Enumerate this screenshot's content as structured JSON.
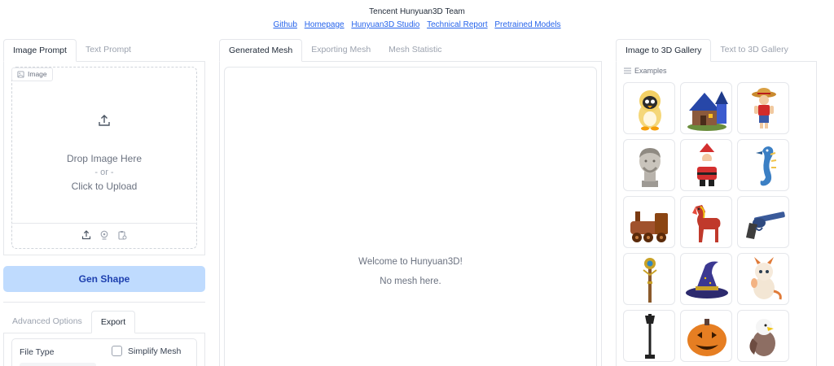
{
  "header": {
    "team": "Tencent Hunyuan3D Team",
    "links": [
      "Github",
      "Homepage",
      "Hunyuan3D Studio",
      "Technical Report",
      "Pretrained Models"
    ]
  },
  "left_panel": {
    "tabs": [
      "Image Prompt",
      "Text Prompt"
    ],
    "image_label": "Image",
    "drop_text": "Drop Image Here",
    "or_text": "- or -",
    "click_text": "Click to Upload",
    "source_icons": [
      "upload-icon",
      "webcam-icon",
      "clipboard-icon"
    ],
    "gen_button": "Gen Shape",
    "option_tabs": [
      "Advanced Options",
      "Export"
    ],
    "file_type_label": "File Type",
    "simplify_label": "Simplify Mesh",
    "simplify_checked": false
  },
  "middle_panel": {
    "tabs": [
      "Generated Mesh",
      "Exporting Mesh",
      "Mesh Statistic"
    ],
    "welcome": "Welcome to Hunyuan3D!",
    "no_mesh": "No mesh here."
  },
  "right_panel": {
    "tabs": [
      "Image to 3D Gallery",
      "Text to 3D Gallery"
    ],
    "examples_label": "Examples",
    "gallery": [
      "penguin-chick-icon",
      "blue-house-icon",
      "straw-hat-pirate-icon",
      "marble-bust-icon",
      "santa-claus-icon",
      "seahorse-icon",
      "steam-train-icon",
      "red-horse-icon",
      "revolver-icon",
      "ornate-staff-icon",
      "witch-hat-icon",
      "baby-dragon-icon",
      "street-lamp-icon",
      "jack-o-lantern-icon",
      "eagle-icon"
    ]
  },
  "colors": {
    "accent_link": "#2563eb",
    "button_bg": "#bfdbfe",
    "button_text": "#1e40af",
    "border": "#e5e7eb"
  }
}
